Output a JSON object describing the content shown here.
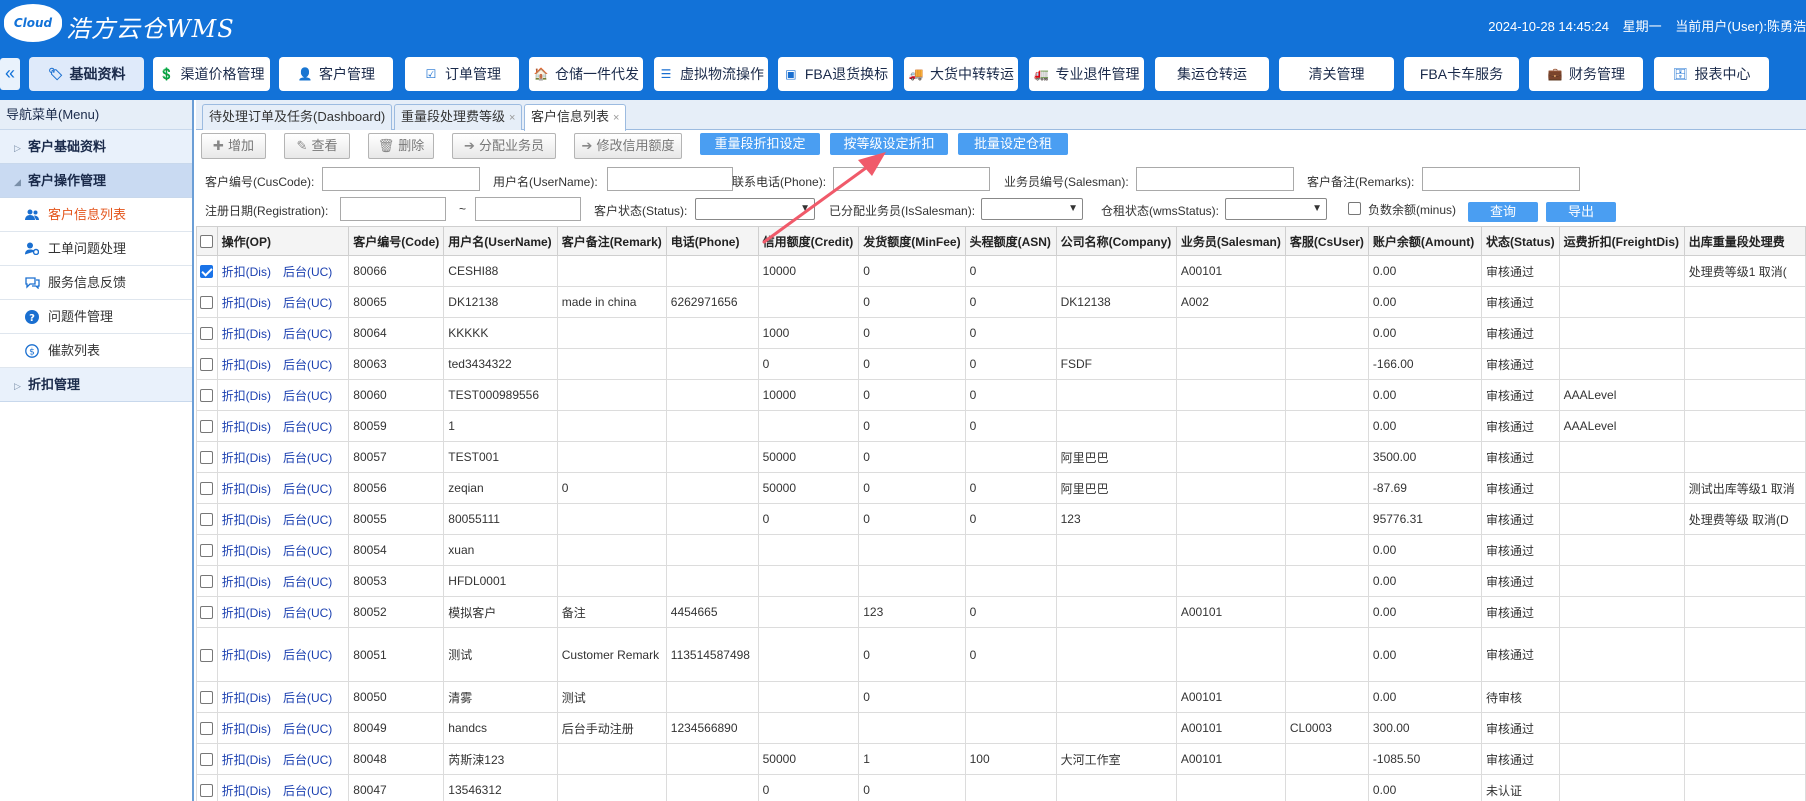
{
  "header": {
    "logo_text": "Cloud",
    "brand": "浩方云仓WMS",
    "datetime": "2024-10-28 14:45:24",
    "weekday": "星期一",
    "current_user": "当前用户(User):陈勇浩"
  },
  "topnav": {
    "collapse": "«",
    "items": [
      {
        "label": "基础资料",
        "icon": "tag-icon"
      },
      {
        "label": "渠道价格管理",
        "icon": "price-icon"
      },
      {
        "label": "客户管理",
        "icon": "user-icon"
      },
      {
        "label": "订单管理",
        "icon": "order-icon"
      },
      {
        "label": "仓储一件代发",
        "icon": "warehouse-icon"
      },
      {
        "label": "虚拟物流操作",
        "icon": "list-icon"
      },
      {
        "label": "FBA退货换标",
        "icon": "fba-icon"
      },
      {
        "label": "大货中转转运",
        "icon": "truck-icon"
      },
      {
        "label": "专业退件管理",
        "icon": "return-icon"
      },
      {
        "label": "集运仓转运",
        "icon": ""
      },
      {
        "label": "清关管理",
        "icon": ""
      },
      {
        "label": "FBA卡车服务",
        "icon": ""
      },
      {
        "label": "财务管理",
        "icon": "finance-icon"
      },
      {
        "label": "报表中心",
        "icon": "database-icon"
      }
    ]
  },
  "sidebar": {
    "title": "导航菜单(Menu)",
    "groups": [
      {
        "label": "客户基础资料"
      },
      {
        "label": "客户操作管理"
      },
      {
        "label": "折扣管理"
      }
    ],
    "items": [
      {
        "label": "客户信息列表",
        "icon": "users-icon"
      },
      {
        "label": "工单问题处理",
        "icon": "user-gear-icon"
      },
      {
        "label": "服务信息反馈",
        "icon": "chat-icon"
      },
      {
        "label": "问题件管理",
        "icon": "question-icon"
      },
      {
        "label": "催款列表",
        "icon": "dollar-icon"
      }
    ]
  },
  "tabs": [
    {
      "label": "待处理订单及任务(Dashboard)"
    },
    {
      "label": "重量段处理费等级",
      "close": "×"
    },
    {
      "label": "客户信息列表",
      "close": "×"
    }
  ],
  "toolbar": {
    "add": "增加",
    "view": "查看",
    "delete": "删除",
    "assign": "分配业务员",
    "credit": "修改信用额度",
    "weight_discount": "重量段折扣设定",
    "level_discount": "按等级设定折扣",
    "batch_rent": "批量设定仓租"
  },
  "filters": {
    "cuscode": "客户编号(CusCode):",
    "username": "用户名(UserName):",
    "phone": "联系电话(Phone):",
    "salesman": "业务员编号(Salesman):",
    "remarks": "客户备注(Remarks):",
    "registration": "注册日期(Registration):",
    "tilde": "~",
    "status": "客户状态(Status):",
    "is_salesman": "已分配业务员(IsSalesman):",
    "wms_status": "仓租状态(wmsStatus):",
    "minus": "负数余额(minus)",
    "search": "查询",
    "export": "导出"
  },
  "table": {
    "headers": [
      "操作(OP)",
      "客户编号(Code)",
      "用户名(UserName)",
      "客户备注(Remark)",
      "电话(Phone)",
      "信用额度(Credit)",
      "发货额度(MinFee)",
      "头程额度(ASN)",
      "公司名称(Company)",
      "业务员(Salesman)",
      "客服(CsUser)",
      "账户余额(Amount)",
      "状态(Status)",
      "运费折扣(FreightDis)",
      "出库重量段处理费"
    ],
    "op_dis": "折扣(Dis)",
    "op_uc": "后台(UC)",
    "rows": [
      {
        "checked": true,
        "code": "80066",
        "user": "CESHI88",
        "remark": "",
        "phone": "",
        "credit": "10000",
        "minfee": "0",
        "asn": "0",
        "company": "",
        "salesman": "A00101",
        "cs": "",
        "amount": "0.00",
        "status": "审核通过",
        "freight": "",
        "level": "处理费等级1 取消(",
        "tall": false
      },
      {
        "checked": false,
        "code": "80065",
        "user": "DK12138",
        "remark": "made in china",
        "phone": "6262971656",
        "credit": "",
        "minfee": "0",
        "asn": "0",
        "company": "DK12138",
        "salesman": "A002",
        "cs": "",
        "amount": "0.00",
        "status": "审核通过",
        "freight": "",
        "level": "",
        "tall": false
      },
      {
        "checked": false,
        "code": "80064",
        "user": "KKKKK",
        "remark": "",
        "phone": "",
        "credit": "1000",
        "minfee": "0",
        "asn": "0",
        "company": "",
        "salesman": "",
        "cs": "",
        "amount": "0.00",
        "status": "审核通过",
        "freight": "",
        "level": "",
        "tall": false
      },
      {
        "checked": false,
        "code": "80063",
        "user": "ted3434322",
        "remark": "",
        "phone": "",
        "credit": "0",
        "minfee": "0",
        "asn": "0",
        "company": "FSDF",
        "salesman": "",
        "cs": "",
        "amount": "-166.00",
        "status": "审核通过",
        "freight": "",
        "level": "",
        "tall": false
      },
      {
        "checked": false,
        "code": "80060",
        "user": "TEST000989556",
        "remark": "",
        "phone": "",
        "credit": "10000",
        "minfee": "0",
        "asn": "0",
        "company": "",
        "salesman": "",
        "cs": "",
        "amount": "0.00",
        "status": "审核通过",
        "freight": "AAALevel",
        "level": "",
        "tall": false
      },
      {
        "checked": false,
        "code": "80059",
        "user": "1",
        "remark": "",
        "phone": "",
        "credit": "",
        "minfee": "0",
        "asn": "0",
        "company": "",
        "salesman": "",
        "cs": "",
        "amount": "0.00",
        "status": "审核通过",
        "freight": "AAALevel",
        "level": "",
        "tall": false
      },
      {
        "checked": false,
        "code": "80057",
        "user": "TEST001",
        "remark": "",
        "phone": "",
        "credit": "50000",
        "minfee": "0",
        "asn": "",
        "company": "阿里巴巴",
        "salesman": "",
        "cs": "",
        "amount": "3500.00",
        "status": "审核通过",
        "freight": "",
        "level": "",
        "tall": false
      },
      {
        "checked": false,
        "code": "80056",
        "user": "zeqian",
        "remark": "0",
        "phone": "",
        "credit": "50000",
        "minfee": "0",
        "asn": "0",
        "company": "阿里巴巴",
        "salesman": "",
        "cs": "",
        "amount": "-87.69",
        "status": "审核通过",
        "freight": "",
        "level": "测试出库等级1 取消",
        "tall": false
      },
      {
        "checked": false,
        "code": "80055",
        "user": "80055111",
        "remark": "",
        "phone": "",
        "credit": "0",
        "minfee": "0",
        "asn": "0",
        "company": "123",
        "salesman": "",
        "cs": "",
        "amount": "95776.31",
        "status": "审核通过",
        "freight": "",
        "level": "处理费等级 取消(D",
        "tall": false
      },
      {
        "checked": false,
        "code": "80054",
        "user": "xuan",
        "remark": "",
        "phone": "",
        "credit": "",
        "minfee": "",
        "asn": "",
        "company": "",
        "salesman": "",
        "cs": "",
        "amount": "0.00",
        "status": "审核通过",
        "freight": "",
        "level": "",
        "tall": false
      },
      {
        "checked": false,
        "code": "80053",
        "user": "HFDL0001",
        "remark": "",
        "phone": "",
        "credit": "",
        "minfee": "",
        "asn": "",
        "company": "",
        "salesman": "",
        "cs": "",
        "amount": "0.00",
        "status": "审核通过",
        "freight": "",
        "level": "",
        "tall": false
      },
      {
        "checked": false,
        "code": "80052",
        "user": "模拟客户",
        "remark": "备注",
        "phone": "4454665",
        "credit": "",
        "minfee": "123",
        "asn": "0",
        "company": "",
        "salesman": "A00101",
        "cs": "",
        "amount": "0.00",
        "status": "审核通过",
        "freight": "",
        "level": "",
        "tall": false
      },
      {
        "checked": false,
        "code": "80051",
        "user": "测试",
        "remark": "Customer Remark",
        "phone": "113514587498",
        "credit": "",
        "minfee": "0",
        "asn": "0",
        "company": "",
        "salesman": "",
        "cs": "",
        "amount": "0.00",
        "status": "审核通过",
        "freight": "",
        "level": "",
        "tall": true
      },
      {
        "checked": false,
        "code": "80050",
        "user": "清雾",
        "remark": "测试",
        "phone": "",
        "credit": "",
        "minfee": "0",
        "asn": "",
        "company": "",
        "salesman": "A00101",
        "cs": "",
        "amount": "0.00",
        "status": "待审核",
        "freight": "",
        "level": "",
        "tall": false
      },
      {
        "checked": false,
        "code": "80049",
        "user": "handcs",
        "remark": "后台手动注册",
        "phone": "1234566890",
        "credit": "",
        "minfee": "",
        "asn": "",
        "company": "",
        "salesman": "A00101",
        "cs": "CL0003",
        "amount": "300.00",
        "status": "审核通过",
        "freight": "",
        "level": "",
        "tall": false
      },
      {
        "checked": false,
        "code": "80048",
        "user": "芮斯涑123",
        "remark": "",
        "phone": "",
        "credit": "50000",
        "minfee": "1",
        "asn": "100",
        "company": "大河工作室",
        "salesman": "A00101",
        "cs": "",
        "amount": "-1085.50",
        "status": "审核通过",
        "freight": "",
        "level": "",
        "tall": false
      },
      {
        "checked": false,
        "code": "80047",
        "user": "13546312",
        "remark": "",
        "phone": "",
        "credit": "0",
        "minfee": "0",
        "asn": "",
        "company": "",
        "salesman": "",
        "cs": "",
        "amount": "0.00",
        "status": "未认证",
        "freight": "",
        "level": "",
        "tall": false
      }
    ]
  }
}
